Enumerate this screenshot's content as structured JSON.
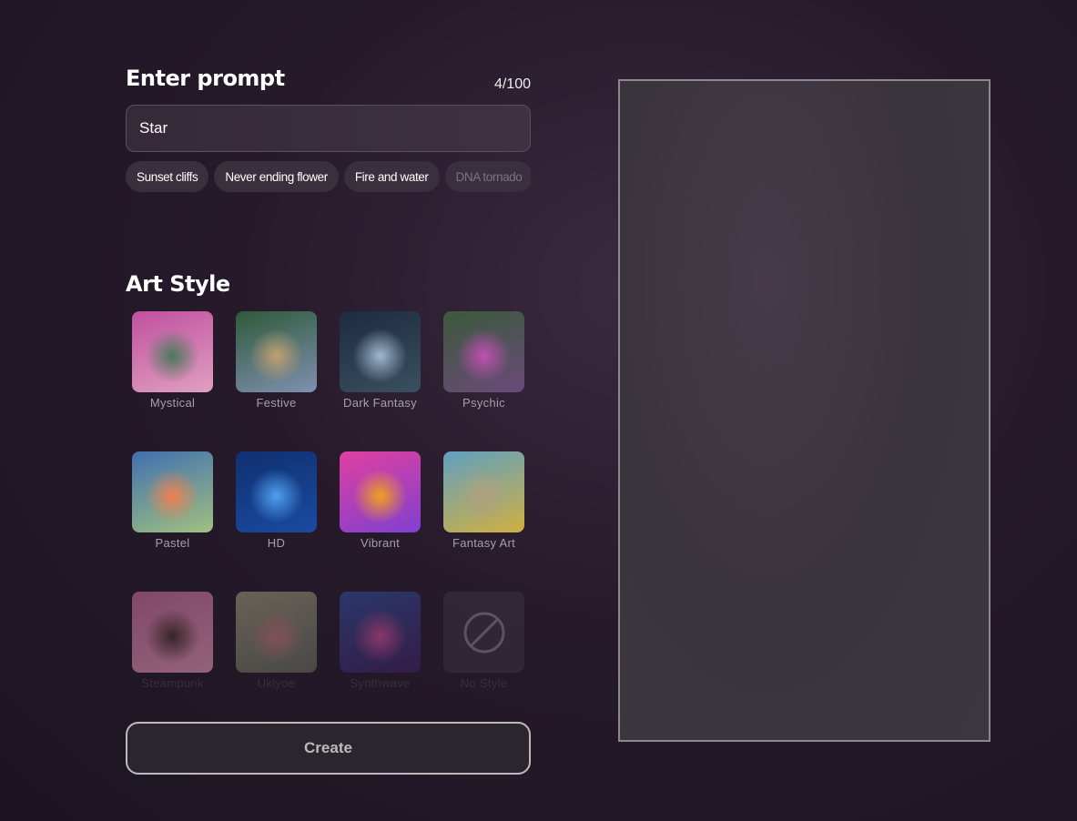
{
  "prompt": {
    "title": "Enter prompt",
    "counter": "4/100",
    "value": "Star",
    "suggestions": [
      "Sunset cliffs",
      "Never ending flower",
      "Fire and water",
      "DNA tornado"
    ]
  },
  "art_style": {
    "title": "Art Style",
    "styles": [
      {
        "label": "Mystical",
        "colors": [
          "#c050a0",
          "#4a7a5a",
          "#e0a0c0"
        ]
      },
      {
        "label": "Festive",
        "colors": [
          "#2e5a3a",
          "#c0a070",
          "#8090b0"
        ]
      },
      {
        "label": "Dark Fantasy",
        "colors": [
          "#1e2a40",
          "#a0b8d0",
          "#3a5060"
        ]
      },
      {
        "label": "Psychic",
        "colors": [
          "#3a5a3a",
          "#c050b0",
          "#6a4a7a"
        ]
      },
      {
        "label": "Pastel",
        "colors": [
          "#4070b0",
          "#f08050",
          "#a0c080"
        ]
      },
      {
        "label": "HD",
        "colors": [
          "#103070",
          "#50a0f0",
          "#1a4aa0"
        ]
      },
      {
        "label": "Vibrant",
        "colors": [
          "#e040a0",
          "#f0a020",
          "#8040d0"
        ]
      },
      {
        "label": "Fantasy Art",
        "colors": [
          "#60a0c0",
          "#b0a080",
          "#d0b040"
        ]
      },
      {
        "label": "Steampunk",
        "colors": [
          "#d070a0",
          "#4a3028",
          "#f0a0c0"
        ]
      },
      {
        "label": "Ukiyoe",
        "colors": [
          "#a0a080",
          "#d08080",
          "#6a7060"
        ]
      },
      {
        "label": "Synthwave",
        "colors": [
          "#3050a0",
          "#e050a0",
          "#402060"
        ]
      },
      {
        "label": "No Style",
        "colors": [
          "#3a3340",
          "#3a3340",
          "#3a3340"
        ]
      }
    ]
  },
  "create_label": "Create"
}
